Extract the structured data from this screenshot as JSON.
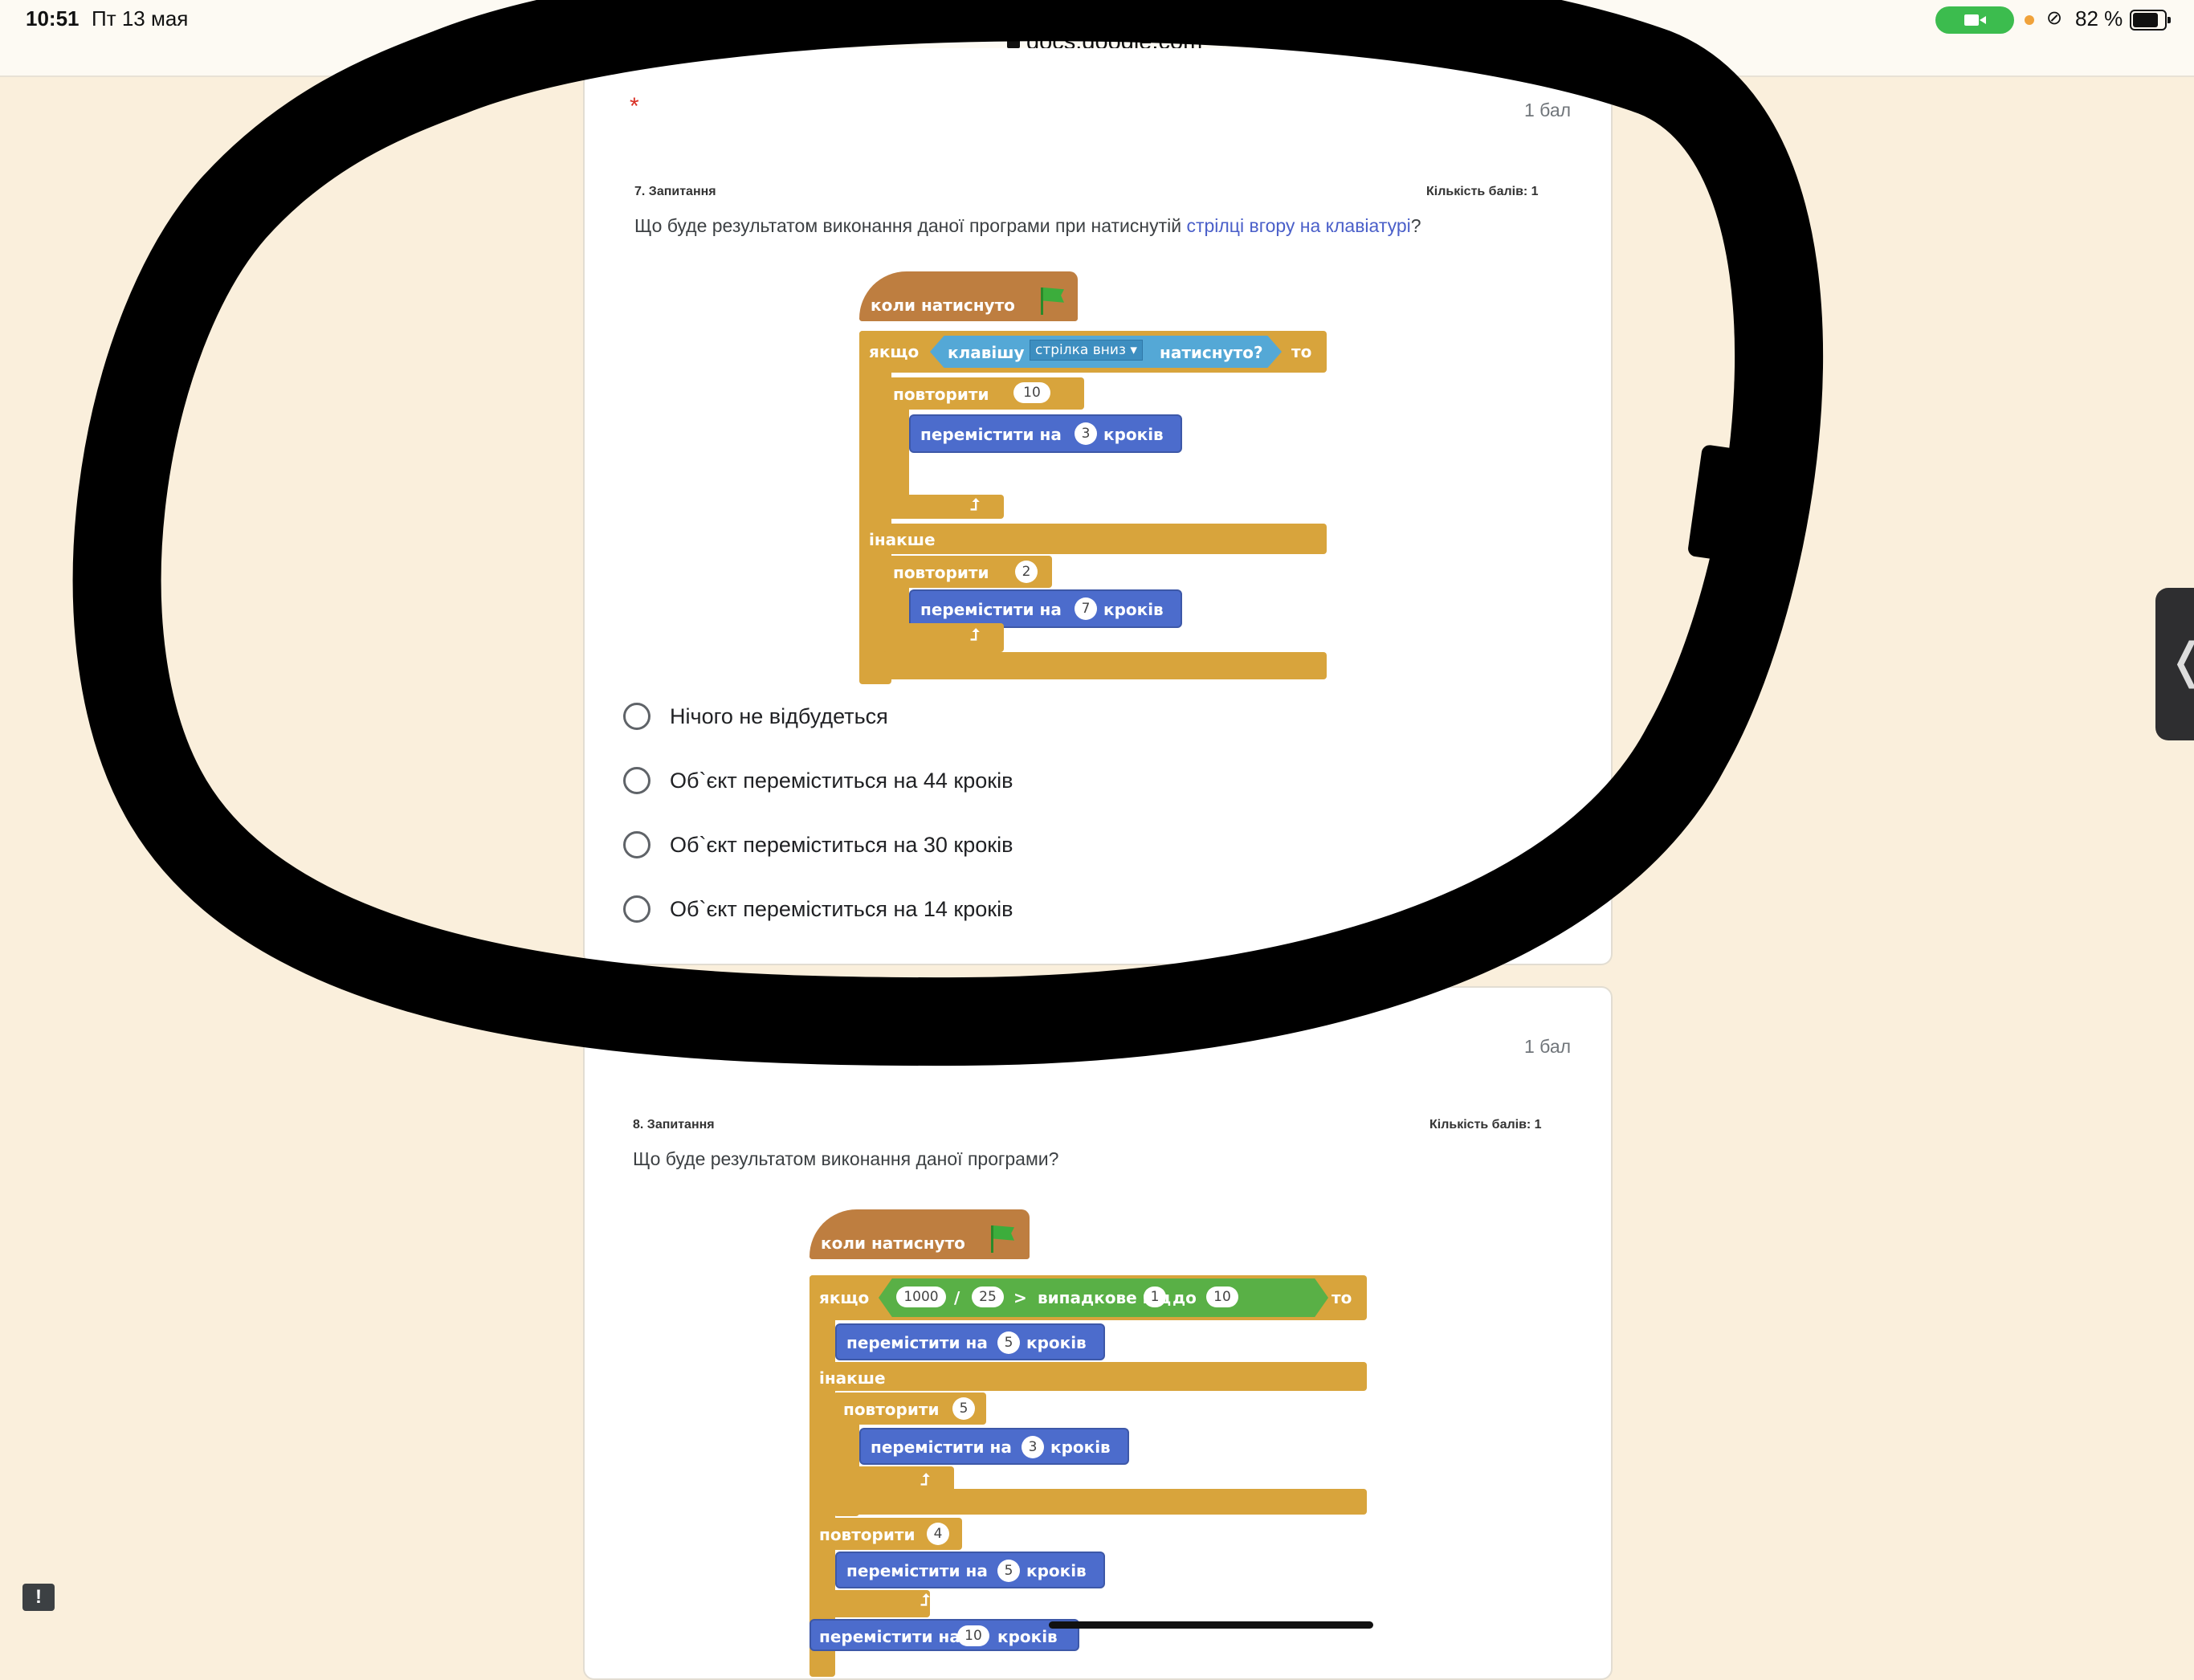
{
  "status_bar": {
    "time": "10:51",
    "date": "Пт 13 мая",
    "url": "docs.google.com",
    "battery": "82 %",
    "dots": "•••"
  },
  "question7": {
    "required_mark": "*",
    "points": "1 бал",
    "number_label": "7. Запитання",
    "points_label": "Кількість балів: 1",
    "text_main": "Що буде результатом виконання даної програми при натиснутій ",
    "text_highlight": "стрілці вгору на клавіатурі",
    "text_end": "?",
    "options": [
      "Нічого не відбудеться",
      "Об`єкт переміститься на 44 кроків",
      "Об`єкт переміститься на 30 кроків",
      "Об`єкт переміститься на 14 кроків"
    ],
    "script": {
      "hat": "коли  натиснуто",
      "if": "якщо",
      "key": "клавішу",
      "key_value": "стрілка вниз ▾",
      "pressed": "натиснуто?",
      "then": "то",
      "repeat": "повторити",
      "repeat1": "10",
      "move": "перемістити  на",
      "steps": "кроків",
      "move1": "3",
      "else": "інакше",
      "repeat2": "2",
      "move2": "7",
      "loop_arrow": "⮥"
    }
  },
  "question8": {
    "required_mark": "*",
    "points": "1 бал",
    "number_label": "8. Запитання",
    "points_label": "Кількість балів: 1",
    "text": "Що буде результатом виконання даної програми?",
    "script": {
      "hat": "коли  натиснуто",
      "if": "якщо",
      "a": "1000",
      "div": "/",
      "b": "25",
      "gt": ">",
      "random": "випадкове  від",
      "from": "1",
      "to_word": "до",
      "to": "10",
      "then": "то",
      "move": "перемістити  на",
      "steps": "кроків",
      "move1": "5",
      "else": "інакше",
      "repeat": "повторити",
      "repeat1": "5",
      "move2": "3",
      "repeat2": "4",
      "move3": "5",
      "move4_text": "перемістити на",
      "move4": "10",
      "loop_arrow": "⮥"
    }
  },
  "feedback_icon": "!",
  "side_handle_icon": "❬"
}
